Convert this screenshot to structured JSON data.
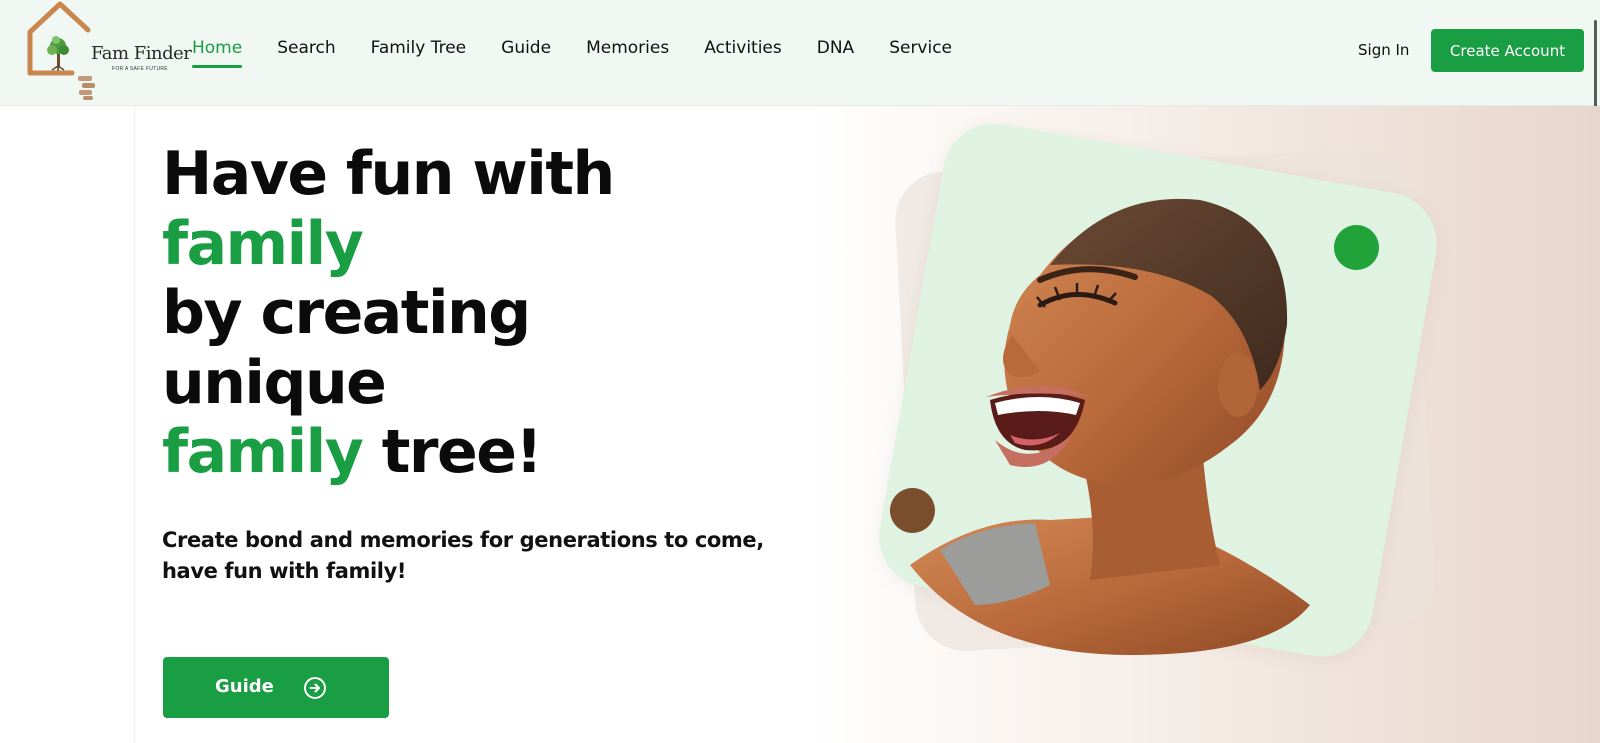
{
  "brand": {
    "name": "Fam Finder",
    "tagline": "FOR A SAFE FUTURE"
  },
  "nav": {
    "items": [
      {
        "label": "Home",
        "active": true
      },
      {
        "label": "Search",
        "active": false
      },
      {
        "label": "Family Tree",
        "active": false
      },
      {
        "label": "Guide",
        "active": false
      },
      {
        "label": "Memories",
        "active": false
      },
      {
        "label": "Activities",
        "active": false
      },
      {
        "label": "DNA",
        "active": false
      },
      {
        "label": "Service",
        "active": false
      }
    ],
    "sign_in": "Sign In",
    "create_account": "Create Account"
  },
  "hero": {
    "line1": "Have fun with",
    "line2": "family",
    "line3": "by creating",
    "line4": "unique",
    "line5_green": "family",
    "line5_rest": " tree!",
    "subtext_line1": "Create bond and memories for generations to come,",
    "subtext_line2": "have fun with family!",
    "button_label": "Guide"
  },
  "colors": {
    "accent_green": "#1a9e43",
    "header_bg": "#f1f7f2",
    "card_bg": "#e0f3e2",
    "dot_green": "#21a33a",
    "dot_brown": "#7a4d2c",
    "logo_orange": "#c8874e"
  },
  "icons": {
    "guide_button_icon": "arrow-right-circle-icon",
    "logo_icon": "house-tree-icon"
  }
}
